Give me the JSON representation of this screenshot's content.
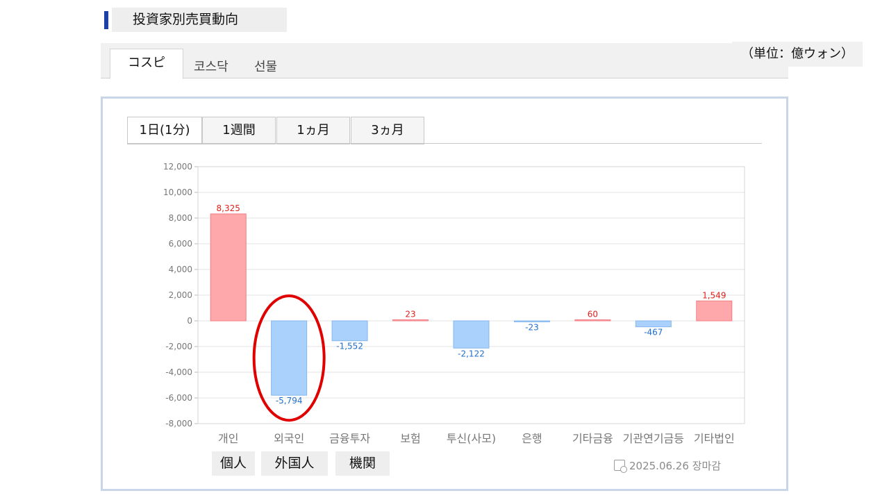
{
  "header": {
    "title": "投資家別売買動向"
  },
  "market_tabs": [
    {
      "label": "コスピ",
      "active": true
    },
    {
      "label": "코스닥",
      "active": false
    },
    {
      "label": "선물",
      "active": false
    }
  ],
  "unit_label": "（単位：億ウォン）",
  "period_tabs": [
    {
      "label": "1日(1分)",
      "active": true
    },
    {
      "label": "1週間",
      "active": false
    },
    {
      "label": "1ヵ月",
      "active": false
    },
    {
      "label": "3ヵ月",
      "active": false
    }
  ],
  "colors": {
    "positive": "#ffa8ab",
    "negative": "#a9d1fb",
    "positive_label": "#e0201a",
    "negative_label": "#1f6fd0",
    "highlight": "#e00000"
  },
  "chart_data": {
    "type": "bar",
    "categories": [
      "개인",
      "외국인",
      "금융투자",
      "보험",
      "투신(사모)",
      "은행",
      "기타금융",
      "기관연기금등",
      "기타법인"
    ],
    "values": [
      8325,
      -5794,
      -1552,
      23,
      -2122,
      -23,
      60,
      -467,
      1549
    ],
    "value_labels": [
      "8,325",
      "-5,794",
      "-1,552",
      "23",
      "-2,122",
      "-23",
      "60",
      "-467",
      "1,549"
    ],
    "ylim": [
      -8000,
      12000
    ],
    "yticks": [
      12000,
      10000,
      8000,
      6000,
      4000,
      2000,
      0,
      -2000,
      -4000,
      -6000,
      -8000
    ],
    "ytick_labels": [
      "12,000",
      "10,000",
      "8,000",
      "6,000",
      "4,000",
      "2,000",
      "0",
      "-2,000",
      "-4,000",
      "-6,000",
      "-8,000"
    ],
    "grid": true,
    "highlighted_category": "외국인"
  },
  "japanese_labels": [
    "個人",
    "外国人",
    "機関"
  ],
  "status": {
    "timestamp": "2025.06.26 장마감"
  }
}
